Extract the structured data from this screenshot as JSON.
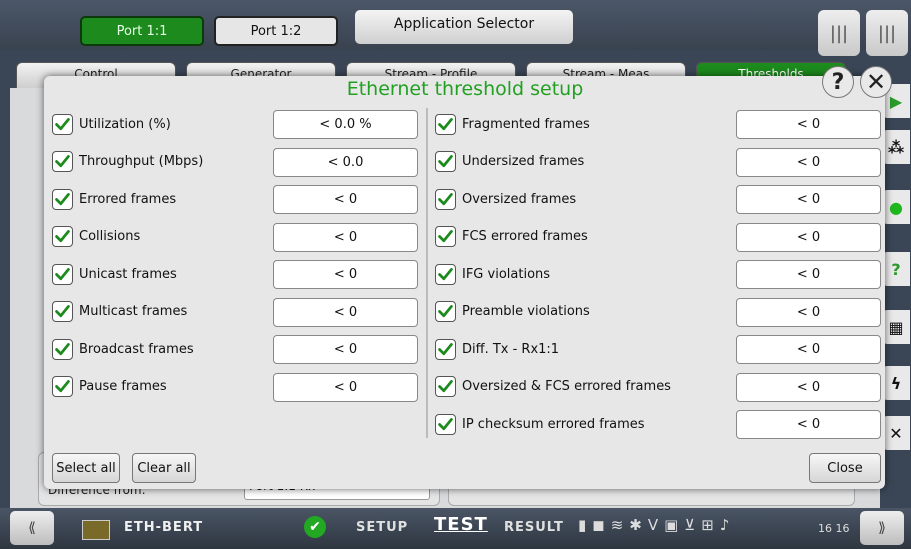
{
  "header": {
    "ports": [
      "Port 1:1",
      "Port 1:2"
    ],
    "app_selector": "Application Selector",
    "tabs": [
      "Control",
      "Generator",
      "Stream - Profile",
      "Stream - Meas",
      "Thresholds"
    ]
  },
  "background": {
    "difference_label": "Difference from:",
    "difference_value": "Port 1:1 Rx"
  },
  "dialog": {
    "title": "Ethernet threshold setup",
    "left": [
      {
        "label": "Utilization (%)",
        "value": "< 0.0 %",
        "checked": true
      },
      {
        "label": "Throughput (Mbps)",
        "value": "< 0.0",
        "checked": true
      },
      {
        "label": "Errored frames",
        "value": "< 0",
        "checked": true
      },
      {
        "label": "Collisions",
        "value": "< 0",
        "checked": true
      },
      {
        "label": "Unicast frames",
        "value": "< 0",
        "checked": true
      },
      {
        "label": "Multicast frames",
        "value": "< 0",
        "checked": true
      },
      {
        "label": "Broadcast frames",
        "value": "< 0",
        "checked": true
      },
      {
        "label": "Pause frames",
        "value": "< 0",
        "checked": true
      }
    ],
    "right": [
      {
        "label": "Fragmented frames",
        "value": "< 0",
        "checked": true
      },
      {
        "label": "Undersized frames",
        "value": "< 0",
        "checked": true
      },
      {
        "label": "Oversized frames",
        "value": "< 0",
        "checked": true
      },
      {
        "label": "FCS errored frames",
        "value": "< 0",
        "checked": true
      },
      {
        "label": "IFG violations",
        "value": "< 0",
        "checked": true
      },
      {
        "label": "Preamble violations",
        "value": "< 0",
        "checked": true
      },
      {
        "label": "Diff. Tx - Rx1:1",
        "value": "< 0",
        "checked": true
      },
      {
        "label": "Oversized & FCS errored frames",
        "value": "< 0",
        "checked": true
      },
      {
        "label": "IP checksum errored frames",
        "value": "< 0",
        "checked": true
      }
    ],
    "select_all": "Select all",
    "clear_all": "Clear all",
    "close": "Close"
  },
  "statusbar": {
    "app_name": "ETH-BERT",
    "setup": "SETUP",
    "test": "TEST",
    "result": "RESULT",
    "time": "16 16"
  },
  "colors": {
    "accent": "#1c8a1c",
    "title": "#22a022"
  }
}
